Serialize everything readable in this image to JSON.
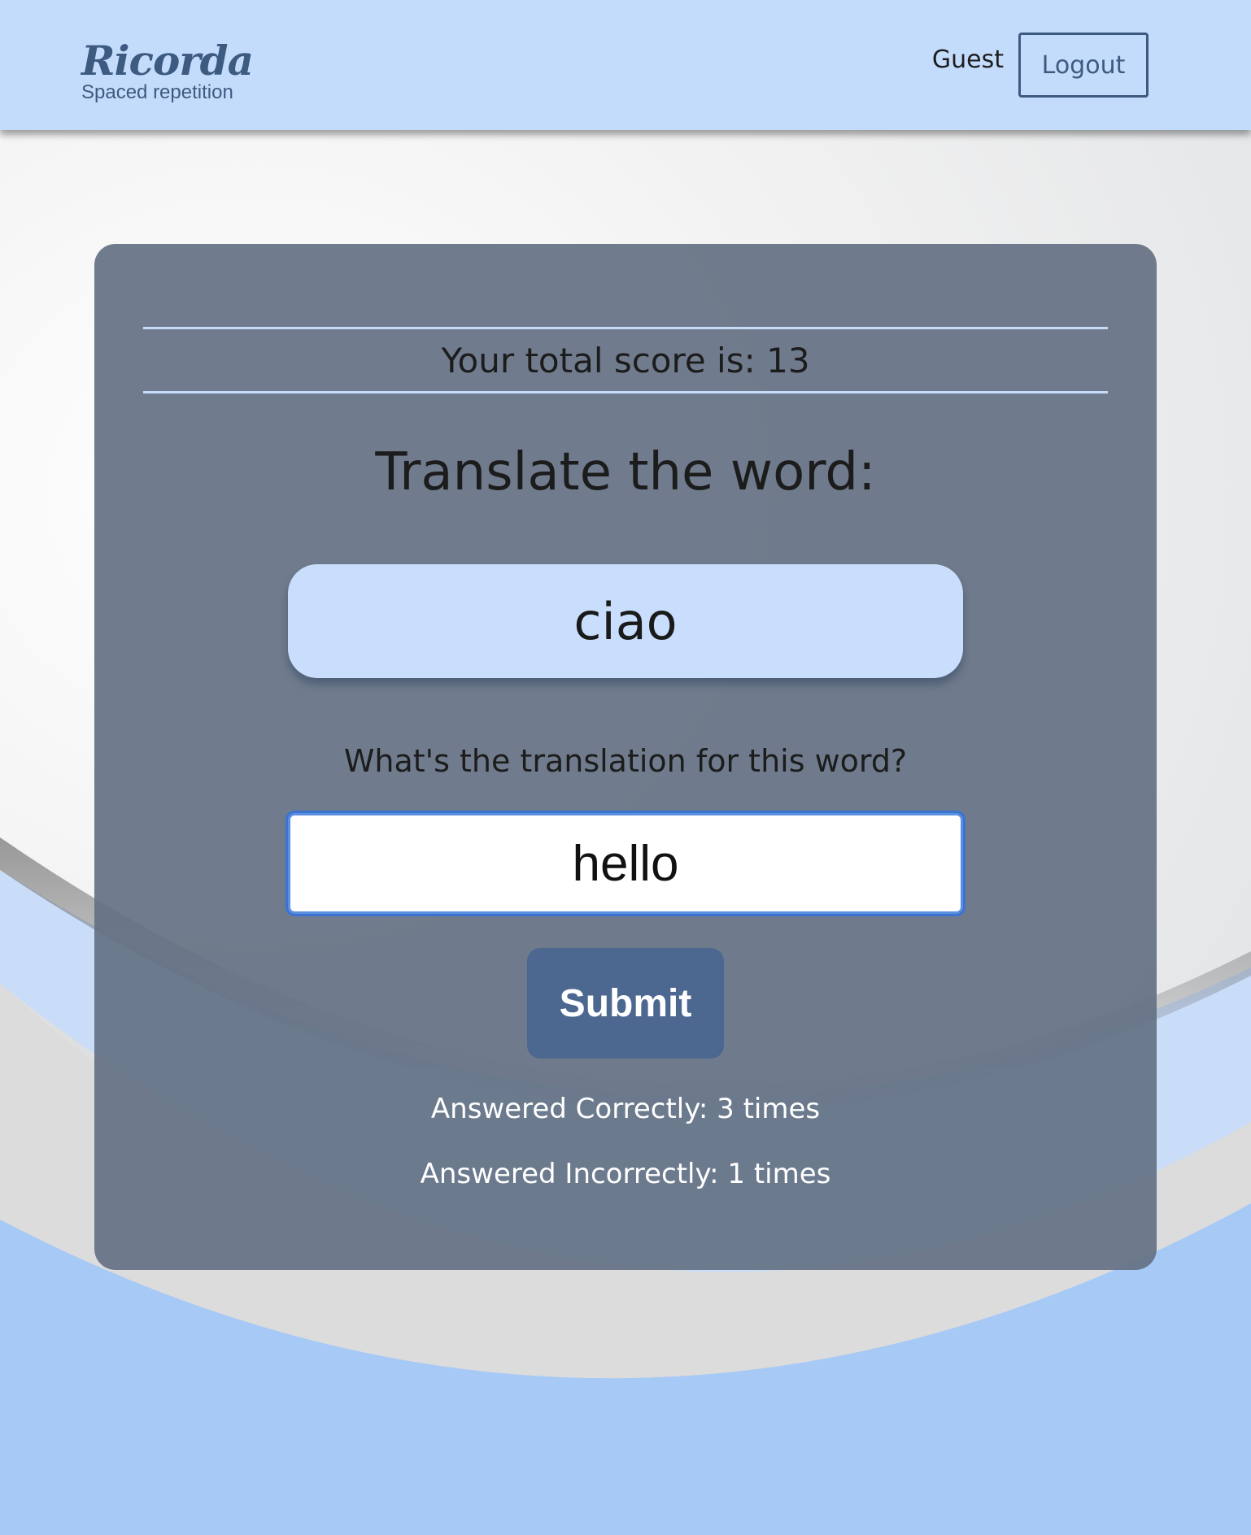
{
  "header": {
    "brand_name": "Ricorda",
    "brand_tagline": "Spaced repetition",
    "user_name": "Guest",
    "logout_label": "Logout"
  },
  "quiz": {
    "score_text": "Your total score is: 13",
    "prompt_title": "Translate the word:",
    "word": "ciao",
    "question": "What's the translation for this word?",
    "answer_value": "hello",
    "submit_label": "Submit",
    "correct_text": "Answered Correctly: 3 times",
    "incorrect_text": "Answered Incorrectly: 1 times"
  },
  "colors": {
    "header_bg": "#c4dcfb",
    "brand": "#3d5a80",
    "card_bg": "#647183",
    "word_box_bg": "#c9defc",
    "submit_bg": "#4c6891",
    "accent_blue": "#a7c9f5"
  }
}
